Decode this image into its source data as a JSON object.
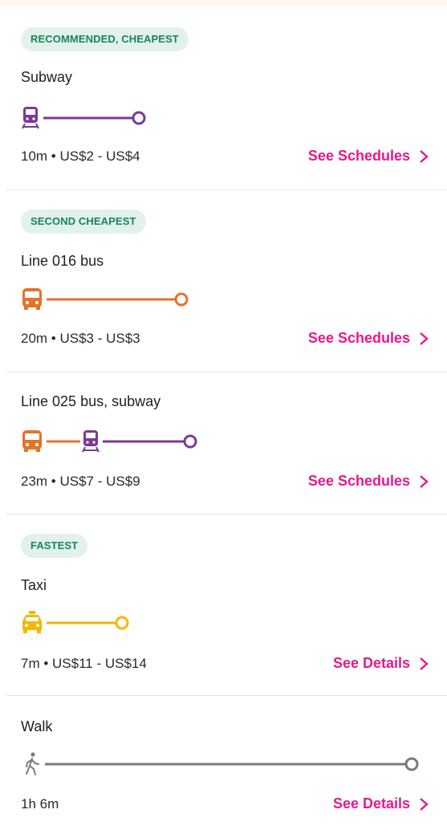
{
  "colors": {
    "subway": "#7b3a93",
    "bus": "#e2742a",
    "taxi": "#f7b500",
    "walk": "#7a7a7a",
    "link": "#e8188b",
    "badge_bg": "#e2f2ea",
    "badge_text": "#17855a"
  },
  "options": [
    {
      "badge": "RECOMMENDED, CHEAPEST",
      "name": "Subway",
      "segments": [
        "subway-icon"
      ],
      "meta": "10m • US$2 - US$4",
      "link": "See Schedules"
    },
    {
      "badge": "SECOND CHEAPEST",
      "name": "Line 016 bus",
      "segments": [
        "bus-icon"
      ],
      "meta": "20m • US$3 - US$3",
      "link": "See Schedules"
    },
    {
      "badge": "",
      "name": "Line 025 bus, subway",
      "segments": [
        "bus-icon",
        "subway-icon"
      ],
      "meta": "23m • US$7 - US$9",
      "link": "See Schedules"
    },
    {
      "badge": "FASTEST",
      "name": "Taxi",
      "segments": [
        "taxi-icon"
      ],
      "meta": "7m • US$11 - US$14",
      "link": "See Details"
    },
    {
      "badge": "",
      "name": "Walk",
      "segments": [
        "walk-icon"
      ],
      "meta": "1h 6m",
      "link": "See Details"
    }
  ]
}
